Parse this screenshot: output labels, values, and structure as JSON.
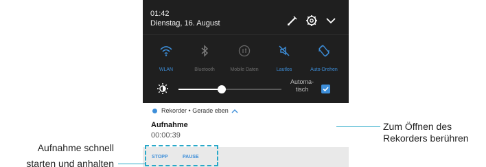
{
  "status": {
    "time": "01:42",
    "date": "Dienstag, 16. August"
  },
  "header_icons": [
    "edit-icon",
    "settings-gear-icon",
    "expand-chevron-icon"
  ],
  "quick_toggles": [
    {
      "label": "WLAN",
      "icon": "wifi-icon",
      "active": true
    },
    {
      "label": "Bluetooth",
      "icon": "bluetooth-icon",
      "active": false
    },
    {
      "label": "Mobile Daten",
      "icon": "mobile-data-icon",
      "active": false
    },
    {
      "label": "Lautlos",
      "icon": "mute-icon",
      "active": true
    },
    {
      "label": "Auto-Drehen",
      "icon": "auto-rotate-icon",
      "active": true
    }
  ],
  "brightness": {
    "icon": "brightness-icon",
    "level": 0.42,
    "auto_label": "Automa-\ntisch",
    "auto_checked": true
  },
  "notification": {
    "app_name": "Rekorder",
    "separator": "•",
    "when": "Gerade eben",
    "title": "Aufnahme",
    "elapsed": "00:00:39",
    "actions": [
      "STOPP",
      "PAUSE"
    ]
  },
  "callouts": {
    "left_line1": "Aufnahme schnell",
    "left_line2": "starten und anhalten",
    "right_line1": "Zum Öffnen des",
    "right_line2": "Rekorders berühren"
  },
  "colors": {
    "accent": "#3d8ed9",
    "shade_background": "#1f1f1f",
    "callout_line": "#28a8c8"
  }
}
